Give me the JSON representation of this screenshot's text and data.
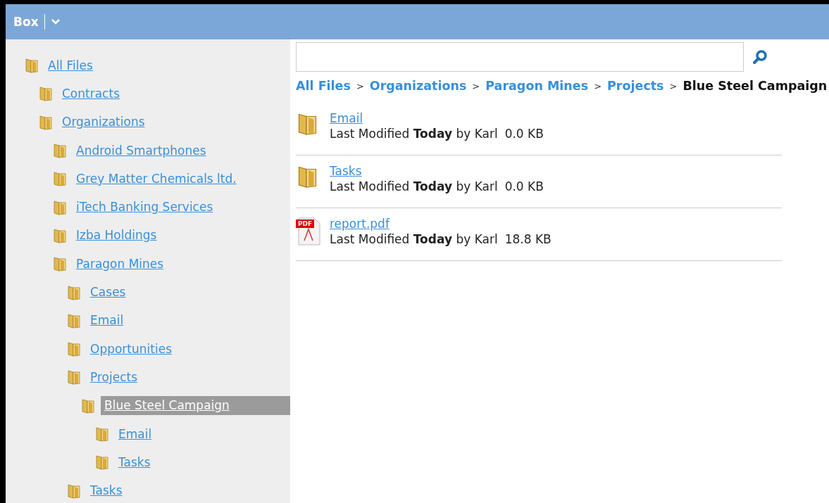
{
  "header": {
    "title": "Box"
  },
  "tree": [
    {
      "label": "All Files",
      "selected": false,
      "children": [
        {
          "label": "Contracts",
          "selected": false
        },
        {
          "label": "Organizations",
          "selected": false,
          "children": [
            {
              "label": "Android Smartphones",
              "selected": false
            },
            {
              "label": "Grey Matter Chemicals ltd.",
              "selected": false
            },
            {
              "label": "iTech Banking Services",
              "selected": false
            },
            {
              "label": "Izba Holdings",
              "selected": false
            },
            {
              "label": "Paragon Mines",
              "selected": false,
              "children": [
                {
                  "label": "Cases",
                  "selected": false
                },
                {
                  "label": "Email",
                  "selected": false
                },
                {
                  "label": "Opportunities",
                  "selected": false
                },
                {
                  "label": "Projects",
                  "selected": false,
                  "children": [
                    {
                      "label": "Blue Steel Campaign",
                      "selected": true,
                      "children": [
                        {
                          "label": "Email",
                          "selected": false
                        },
                        {
                          "label": "Tasks",
                          "selected": false
                        }
                      ]
                    }
                  ]
                },
                {
                  "label": "Tasks",
                  "selected": false
                }
              ]
            }
          ]
        }
      ]
    }
  ],
  "breadcrumb": {
    "separator": ">",
    "items": [
      {
        "label": "All Files",
        "current": false
      },
      {
        "label": "Organizations",
        "current": false
      },
      {
        "label": "Paragon Mines",
        "current": false
      },
      {
        "label": "Projects",
        "current": false
      },
      {
        "label": "Blue Steel Campaign",
        "current": true
      }
    ]
  },
  "files": [
    {
      "kind": "folder",
      "name": "Email",
      "modified": "Last Modified **Today** by Karl",
      "size": "0.0 KB"
    },
    {
      "kind": "folder",
      "name": "Tasks",
      "modified": "Last Modified **Today** by Karl",
      "size": "0.0 KB"
    },
    {
      "kind": "pdf",
      "name": "report.pdf",
      "badge": "PDF",
      "modified": "Last Modified **Today** by Karl",
      "size": "18.8 KB"
    }
  ]
}
